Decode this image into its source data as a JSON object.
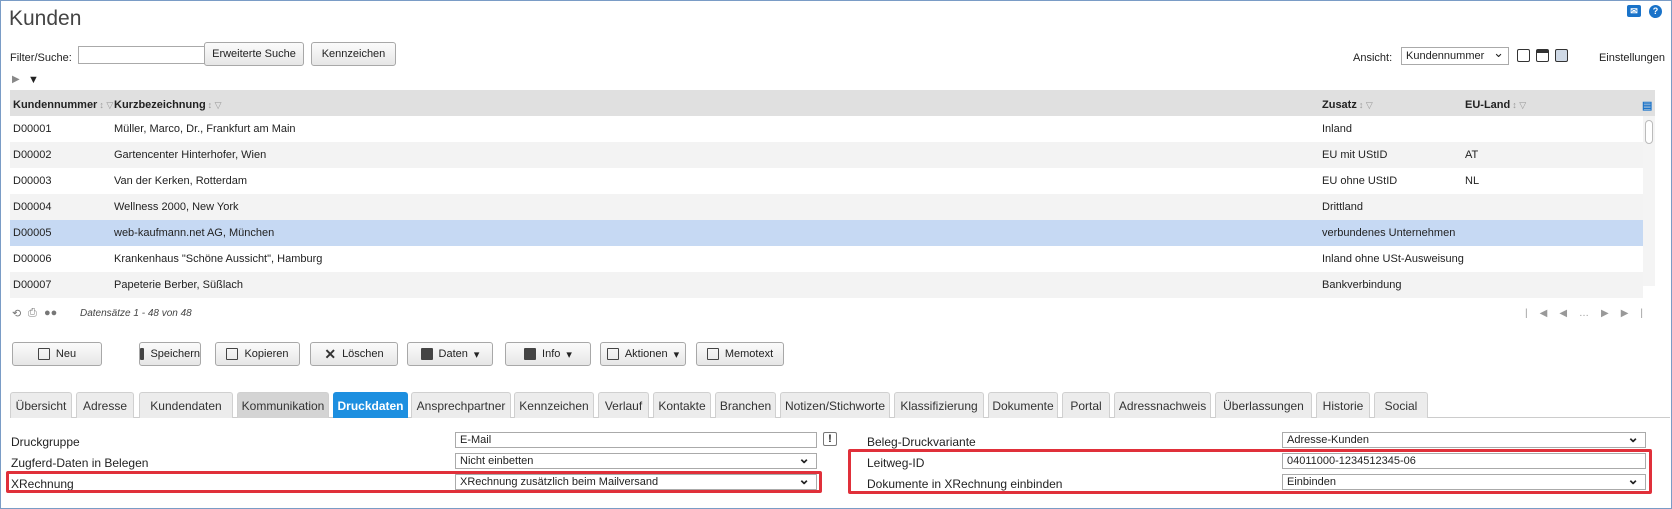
{
  "page": {
    "title": "Kunden"
  },
  "filter": {
    "label": "Filter/Suche:",
    "value": "",
    "extended_search": "Erweiterte Suche",
    "tags": "Kennzeichen",
    "view_label": "Ansicht:",
    "view_value": "Kundennummer",
    "settings": "Einstellungen"
  },
  "grid": {
    "columns": [
      "Kundennummer",
      "Kurzbezeichnung",
      "Zusatz",
      "EU-Land"
    ],
    "rows": [
      {
        "id": "D00001",
        "name": "Müller, Marco, Dr., Frankfurt am Main",
        "zusatz": "Inland",
        "eu": ""
      },
      {
        "id": "D00002",
        "name": "Gartencenter Hinterhofer, Wien",
        "zusatz": "EU mit UStID",
        "eu": "AT"
      },
      {
        "id": "D00003",
        "name": "Van der Kerken, Rotterdam",
        "zusatz": "EU ohne UStID",
        "eu": "NL"
      },
      {
        "id": "D00004",
        "name": "Wellness 2000, New York",
        "zusatz": "Drittland",
        "eu": ""
      },
      {
        "id": "D00005",
        "name": "web-kaufmann.net AG, München",
        "zusatz": "verbundenes Unternehmen",
        "eu": ""
      },
      {
        "id": "D00006",
        "name": "Krankenhaus \"Schöne Aussicht\", Hamburg",
        "zusatz": "Inland ohne USt-Ausweisung",
        "eu": ""
      },
      {
        "id": "D00007",
        "name": "Papeterie Berber, Süßlach",
        "zusatz": "Bankverbindung",
        "eu": ""
      }
    ],
    "record_count": "Datensätze 1 - 48 von 48"
  },
  "actions": {
    "new": "Neu",
    "save": "Speichern",
    "copy": "Kopieren",
    "delete": "Löschen",
    "data": "Daten",
    "info": "Info",
    "actions": "Aktionen",
    "memo": "Memotext"
  },
  "tabs": [
    "Übersicht",
    "Adresse",
    "Kundendaten",
    "Kommunikation",
    "Druckdaten",
    "Ansprechpartner",
    "Kennzeichen",
    "Verlauf",
    "Kontakte",
    "Branchen",
    "Notizen/Stichworte",
    "Klassifizierung",
    "Dokumente",
    "Portal",
    "Adressnachweis",
    "Überlassungen",
    "Historie",
    "Social"
  ],
  "form": {
    "print_group_label": "Druckgruppe",
    "print_group_value": "E-Mail",
    "zugferd_label": "Zugferd-Daten in Belegen",
    "zugferd_value": "Nicht einbetten",
    "xrechnung_label": "XRechnung",
    "xrechnung_value": "XRechnung zusätzlich beim Mailversand",
    "print_variant_label": "Beleg-Druckvariante",
    "print_variant_value": "Adresse-Kunden",
    "leitweg_label": "Leitweg-ID",
    "leitweg_value": "04011000-1234512345-06",
    "embed_docs_label": "Dokumente in XRechnung einbinden",
    "embed_docs_value": "Einbinden"
  },
  "colors": {
    "accent": "#1d8fe0",
    "selected_row": "#c6d9f3",
    "highlight": "#e0303a"
  }
}
